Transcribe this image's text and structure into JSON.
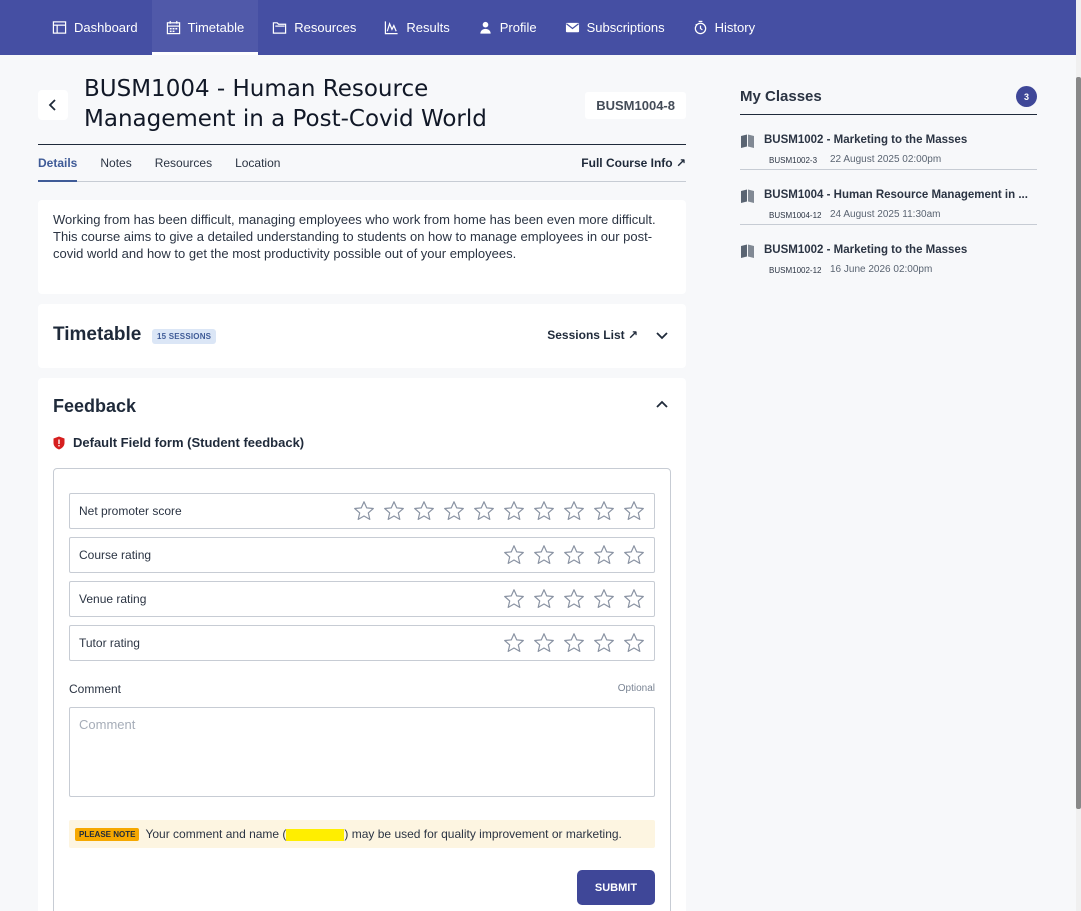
{
  "nav": {
    "items": [
      {
        "label": "Dashboard",
        "icon": "dashboard-icon"
      },
      {
        "label": "Timetable",
        "icon": "calendar-icon",
        "active": true
      },
      {
        "label": "Resources",
        "icon": "folder-icon"
      },
      {
        "label": "Results",
        "icon": "chart-icon"
      },
      {
        "label": "Profile",
        "icon": "person-icon"
      },
      {
        "label": "Subscriptions",
        "icon": "mail-icon"
      },
      {
        "label": "History",
        "icon": "history-icon"
      }
    ]
  },
  "course": {
    "title": "BUSM1004 - Human Resource Management in a Post-Covid World",
    "code": "BUSM1004-8",
    "tabs": [
      "Details",
      "Notes",
      "Resources",
      "Location"
    ],
    "full_info": "Full Course Info ↗",
    "description": "Working from has been difficult, managing employees who work from home has been even more difficult. This course aims to give a detailed understanding to students on how to manage employees in our post-covid world and how to get the most productivity possible out of your employees."
  },
  "timetable": {
    "title": "Timetable",
    "sessions_badge": "15 SESSIONS",
    "sessions_list": "Sessions List ↗"
  },
  "feedback": {
    "title": "Feedback",
    "form_name": "Default Field form (Student feedback)",
    "ratings": [
      {
        "label": "Net promoter score",
        "stars": 10,
        "value": 0
      },
      {
        "label": "Course rating",
        "stars": 5,
        "value": 0
      },
      {
        "label": "Venue rating",
        "stars": 5,
        "value": 0
      },
      {
        "label": "Tutor rating",
        "stars": 5,
        "value": 0
      }
    ],
    "comment_label": "Comment",
    "optional": "Optional",
    "comment_placeholder": "Comment",
    "note_badge": "PLEASE NOTE",
    "note_before": "Your comment and name (",
    "note_after": ") may be used for quality improvement or marketing.",
    "submit": "SUBMIT"
  },
  "side": {
    "title": "My Classes",
    "count": "3",
    "classes": [
      {
        "name": "BUSM1002 - Marketing to the Masses",
        "code": "BUSM1002-3",
        "date": "22 August 2025 02:00pm"
      },
      {
        "name": "BUSM1004 - Human Resource Management in ...",
        "code": "BUSM1004-12",
        "date": "24 August 2025 11:30am"
      },
      {
        "name": "BUSM1002 - Marketing to the Masses",
        "code": "BUSM1002-12",
        "date": "16 June 2026 02:00pm"
      }
    ]
  },
  "colors": {
    "nav": "#454fa3",
    "accent": "#3f4798",
    "badge": "#f6a800"
  }
}
